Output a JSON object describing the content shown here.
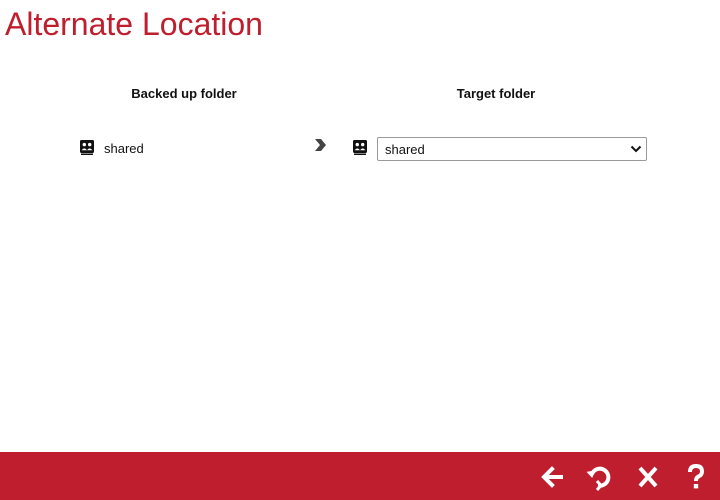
{
  "header": {
    "title": "Alternate Location"
  },
  "columns": {
    "source_header": "Backed up folder",
    "target_header": "Target folder"
  },
  "mapping": {
    "source_folder": "shared",
    "source_icon": "shared-folder-icon",
    "arrow_icon": "chevron-right-icon",
    "target_icon": "shared-folder-icon",
    "target_selected": "shared"
  },
  "footer": {
    "buttons": [
      {
        "name": "back",
        "icon": "arrow-left-icon"
      },
      {
        "name": "restore",
        "icon": "restore-icon"
      },
      {
        "name": "close",
        "icon": "close-icon"
      },
      {
        "name": "help",
        "icon": "help-icon"
      }
    ]
  },
  "colors": {
    "brand": "#be1e2d",
    "footer_icon": "#ffffff"
  }
}
